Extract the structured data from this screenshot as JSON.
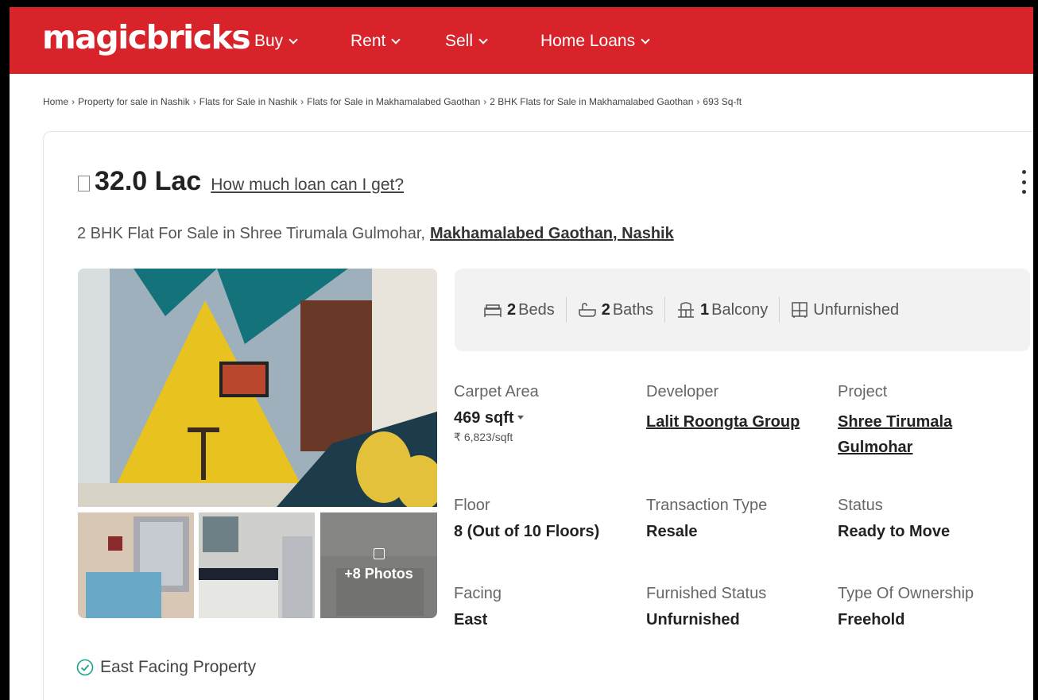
{
  "brand": "magicbricks",
  "nav": [
    {
      "label": "Buy"
    },
    {
      "label": "Rent"
    },
    {
      "label": "Sell"
    },
    {
      "label": "Home Loans"
    }
  ],
  "breadcrumb": [
    "Home",
    "Property for sale in Nashik",
    "Flats for Sale in Nashik",
    "Flats for Sale in Makhamalabed Gaothan",
    "2 BHK Flats for Sale in Makhamalabed Gaothan",
    "693 Sq-ft"
  ],
  "listing": {
    "price": "32.0 Lac",
    "loan_link": "How much loan can I get?",
    "title": "2 BHK Flat For Sale in Shree Tirumala Gulmohar,",
    "location": "Makhamalabed Gaothan, Nashik",
    "photos_more": "+8 Photos"
  },
  "amenities": {
    "beds_count": "2",
    "beds_label": "Beds",
    "baths_count": "2",
    "baths_label": "Baths",
    "balcony_count": "1",
    "balcony_label": "Balcony",
    "furnishing": "Unfurnished"
  },
  "specs": {
    "carpet_area_label": "Carpet Area",
    "carpet_area_value": "469 sqft",
    "price_per_sqft": "6,823/sqft",
    "developer_label": "Developer",
    "developer_value": "Lalit Roongta Group",
    "project_label": "Project",
    "project_value_1": "Shree Tirumala",
    "project_value_2": "Gulmohar",
    "floor_label": "Floor",
    "floor_value": "8 (Out of 10 Floors)",
    "transaction_label": "Transaction Type",
    "transaction_value": "Resale",
    "status_label": "Status",
    "status_value": "Ready to Move",
    "facing_label": "Facing",
    "facing_value": "East",
    "furnished_label": "Furnished Status",
    "furnished_value": "Unfurnished",
    "ownership_label": "Type Of Ownership",
    "ownership_value": "Freehold"
  },
  "feature": "East Facing Property",
  "colors": {
    "brand_red": "#d8232a",
    "text_dark": "#222222",
    "text_muted": "#666666",
    "check_teal": "#1aa38a"
  }
}
